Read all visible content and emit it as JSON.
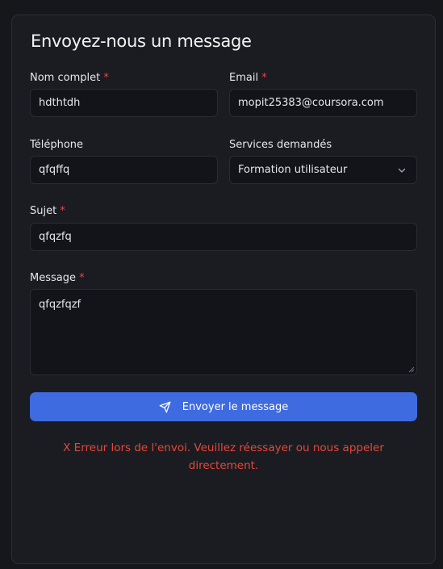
{
  "form": {
    "title": "Envoyez-nous un message",
    "required_marker": "*",
    "name": {
      "label": "Nom complet",
      "value": "hdthtdh"
    },
    "email": {
      "label": "Email",
      "value": "mopit25383@coursora.com"
    },
    "phone": {
      "label": "Téléphone",
      "value": "qfqffq"
    },
    "services": {
      "label": "Services demandés",
      "value": "Formation utilisateur"
    },
    "subject": {
      "label": "Sujet",
      "value": "qfqzfq"
    },
    "message": {
      "label": "Message",
      "value": "qfqzfqzf"
    },
    "submit_label": "Envoyer le message",
    "error_text": "X Erreur lors de l'envoi. Veuillez réessayer ou nous appeler directement."
  },
  "colors": {
    "accent": "#3f6be0",
    "required": "#ef4444",
    "error": "#e5483b"
  },
  "icons": {
    "submit": "send-icon",
    "select": "chevron-down-icon"
  }
}
